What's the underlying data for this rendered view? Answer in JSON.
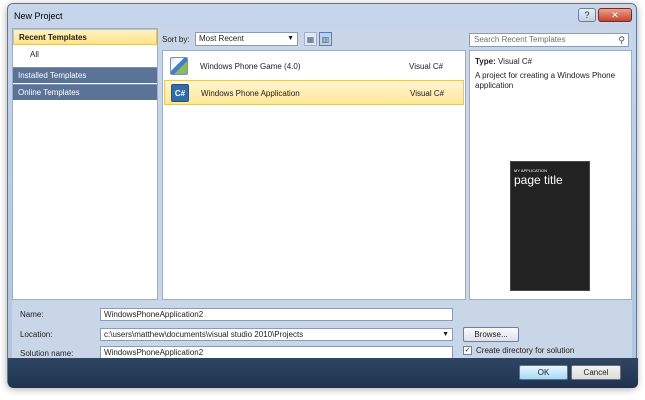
{
  "window": {
    "title": "New Project"
  },
  "nav": {
    "items": [
      {
        "label": "Recent Templates"
      },
      {
        "label": "All"
      },
      {
        "label": "Installed Templates"
      },
      {
        "label": "Online Templates"
      }
    ]
  },
  "sort": {
    "label": "Sort by:",
    "value": "Most Recent"
  },
  "templates": [
    {
      "name": "Windows Phone Game (4.0)",
      "lang": "Visual C#"
    },
    {
      "name": "Windows Phone Application",
      "lang": "Visual C#"
    }
  ],
  "search": {
    "placeholder": "Search Recent Templates"
  },
  "details": {
    "type_label": "Type:",
    "type_value": "Visual C#",
    "description": "A project for creating a Windows Phone application",
    "preview_app": "MY APPLICATION",
    "preview_title": "page title"
  },
  "form": {
    "name_label": "Name:",
    "name_value": "WindowsPhoneApplication2",
    "location_label": "Location:",
    "location_value": "c:\\users\\matthew\\documents\\visual studio 2010\\Projects",
    "solution_label": "Solution name:",
    "solution_value": "WindowsPhoneApplication2",
    "browse_label": "Browse...",
    "create_dir_label": "Create directory for solution",
    "create_dir_checked": true
  },
  "buttons": {
    "ok": "OK",
    "cancel": "Cancel"
  },
  "colors": {
    "nav_selected": "#ffe28a",
    "nav_header": "#5a7397",
    "footer": "#1f3350"
  }
}
